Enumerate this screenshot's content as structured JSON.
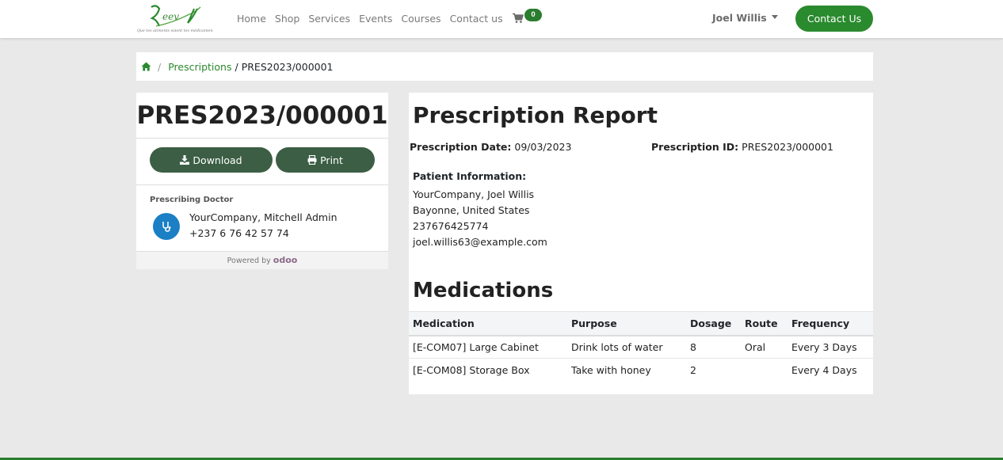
{
  "header": {
    "logo_text": "ReevY",
    "logo_tagline": "Que tes aliments soient tes médicaments",
    "nav": [
      "Home",
      "Shop",
      "Services",
      "Events",
      "Courses",
      "Contact us"
    ],
    "cart_count": "0",
    "user_name": "Joel Willis",
    "contact_button": "Contact Us"
  },
  "breadcrumb": {
    "separator": "/",
    "prescriptions": "Prescriptions",
    "separator2": "/",
    "current": "PRES2023/000001"
  },
  "sidebar": {
    "title": "PRES2023/000001",
    "download_label": "Download",
    "print_label": "Print",
    "doctor_label": "Prescribing Doctor",
    "doctor_name": "YourCompany, Mitchell Admin",
    "doctor_phone": "+237 6 76 42 57 74",
    "powered_by": "Powered by",
    "odoo": "odoo"
  },
  "report": {
    "title": "Prescription Report",
    "date_label": "Prescription Date:",
    "date_value": "09/03/2023",
    "id_label": "Prescription ID:",
    "id_value": "PRES2023/000001",
    "patient_label": "Patient Information:",
    "patient_lines": [
      "YourCompany, Joel Willis",
      "Bayonne, United States",
      "237676425774",
      "joel.willis63@example.com"
    ],
    "medications_title": "Medications",
    "columns": [
      "Medication",
      "Purpose",
      "Dosage",
      "Route",
      "Frequency"
    ],
    "rows": [
      [
        "[E-COM07] Large Cabinet",
        "Drink lots of water",
        "8",
        "Oral",
        "Every 3 Days"
      ],
      [
        "[E-COM08] Storage Box",
        "Take with honey",
        "2",
        "",
        "Every 4 Days"
      ]
    ]
  },
  "colors": {
    "brand_green": "#2a8a2e",
    "dark_button": "#3b5e44",
    "doctor_avatar": "#1a7fc4"
  },
  "icons": [
    "cart-icon",
    "home-icon",
    "download-icon",
    "print-icon",
    "stethoscope-icon",
    "caret-down-icon"
  ]
}
